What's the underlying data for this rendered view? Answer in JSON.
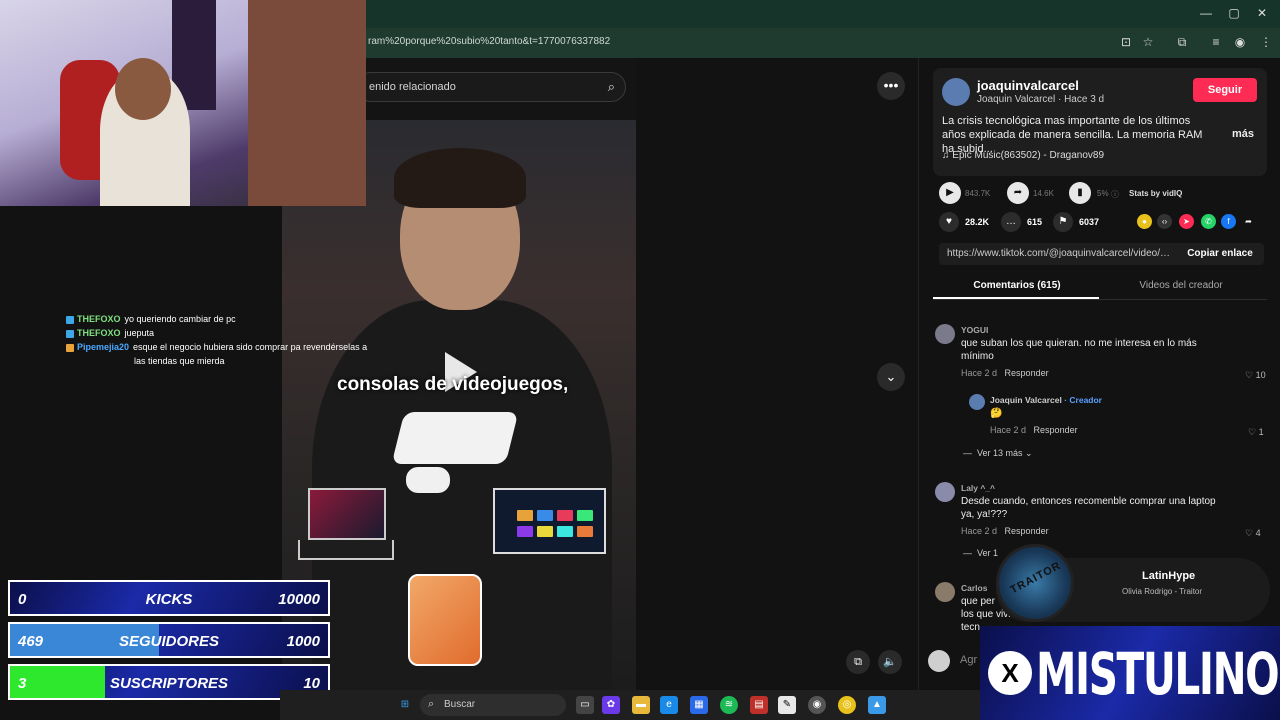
{
  "browser": {
    "url": "ram%20porque%20subio%20tanto&t=1770076337882",
    "window_controls": {
      "minimize": "—",
      "maximize": "▢",
      "close": "✕"
    }
  },
  "search": {
    "placeholder": "enido relacionado"
  },
  "video": {
    "caption": "consolas de videojuegos,"
  },
  "chat": [
    {
      "user": "THEFOXO",
      "message": "yo queriendo cambiar de pc",
      "color": "#7fe07f"
    },
    {
      "user": "THEFOXO",
      "message": "jueputa",
      "color": "#7fe07f"
    },
    {
      "user": "Pipemejia20",
      "message": "esque el negocio hubiera sido comprar pa revendérselas a",
      "message2": "las tiendas que mierda",
      "color": "#4aa8ff"
    }
  ],
  "goal_bars": [
    {
      "value": "0",
      "label": "KICKS",
      "goal": "10000",
      "fill_color": "#1a1f8a",
      "progress": 0.0
    },
    {
      "value": "469",
      "label": "SEGUIDORES",
      "goal": "1000",
      "fill_color": "#3a87d8",
      "progress": 0.469
    },
    {
      "value": "3",
      "label": "SUSCRIPTORES",
      "goal": "10",
      "fill_color": "#2ee82e",
      "progress": 0.3
    }
  ],
  "post": {
    "author_handle": "joaquinvalcarcel",
    "author_name": "Joaquin Valcarcel · Hace 3 d",
    "follow_label": "Seguir",
    "description": "La crisis tecnológica mas importante de los últimos años explicada de manera sencilla. La memoria RAM ha subid...",
    "more_label": "más",
    "music": "Epic Music(863502) - Draganov89"
  },
  "stats": {
    "plays": "843.7K",
    "shares_stat": "14.6K",
    "percent": "5%",
    "stats_by": "Stats by vidIQ"
  },
  "actions": {
    "likes": "28.2K",
    "comments": "615",
    "saves": "6037"
  },
  "share_link": {
    "url": "https://www.tiktok.com/@joaquinvalcarcel/video/7...",
    "copy_label": "Copiar enlace"
  },
  "tabs": [
    {
      "label": "Comentarios (615)",
      "active": true
    },
    {
      "label": "Videos del creador",
      "active": false
    }
  ],
  "comments": [
    {
      "user": "YOGUI",
      "text1": "que suban los que quieran. no me interesa en lo más",
      "text2": "mínimo",
      "time": "Hace 2 d",
      "reply": "Responder",
      "likes": "10"
    },
    {
      "user": "Joaquin Valcarcel",
      "creator_tag": "· Creador",
      "text1": "🤔",
      "time": "Hace 2 d",
      "reply": "Responder",
      "likes": "1"
    },
    {
      "more_replies": "Ver 13 más"
    },
    {
      "user": "Laly ^_^",
      "text1": "Desde cuando, entonces recomenble comprar una laptop",
      "text2": "ya, ya!???",
      "time": "Hace 2 d",
      "reply": "Responder",
      "likes": "4"
    },
    {
      "more_replies": "Ver 1"
    },
    {
      "user": "Carlos",
      "text1": "que per",
      "text2": "los que vivi            e los 90s hacia atrás saben vivir sin",
      "text3": "tecn"
    }
  ],
  "now_playing": {
    "title": "LatinHype",
    "subtitle": "Olivia Rodrigo - Traitor",
    "disc_text": "TRAITOR"
  },
  "brand": {
    "name": "MISTULINO"
  },
  "input_placeholder": "Agr",
  "taskbar": {
    "search_label": "Buscar"
  },
  "colors": {
    "accent": "#fe2c55",
    "browser_frame": "#17342a"
  }
}
